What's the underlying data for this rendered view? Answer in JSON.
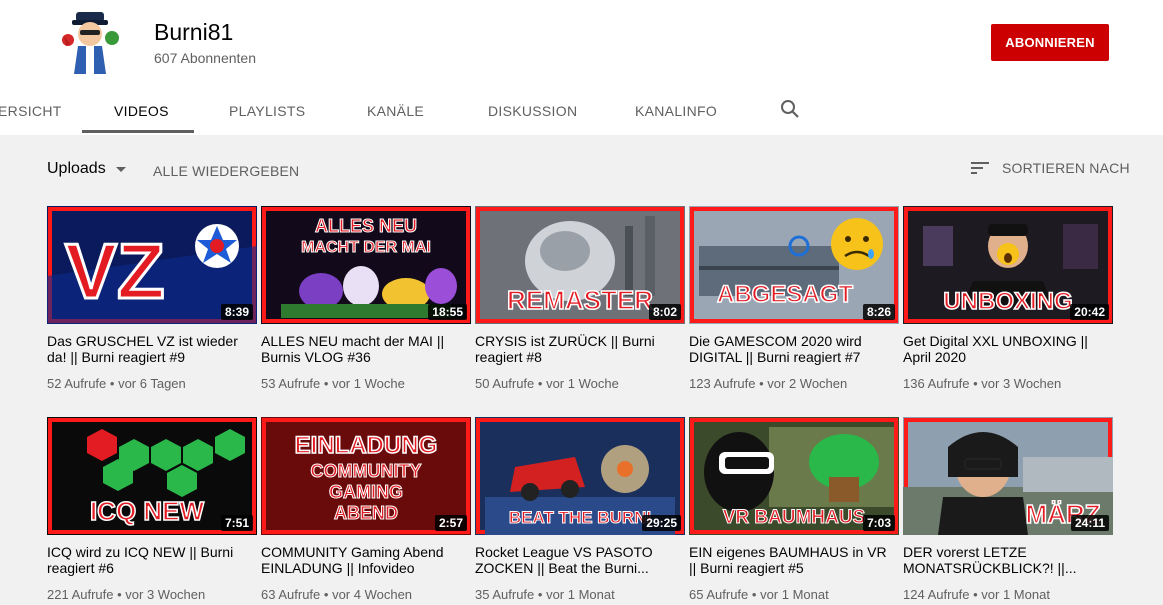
{
  "channel": {
    "name": "Burni81",
    "subscribers": "607 Abonnenten",
    "subscribe_label": "ABONNIEREN"
  },
  "tabs": [
    {
      "label": "ÜBERSICHT"
    },
    {
      "label": "VIDEOS"
    },
    {
      "label": "PLAYLISTS"
    },
    {
      "label": "KANÄLE"
    },
    {
      "label": "DISKUSSION"
    },
    {
      "label": "KANALINFO"
    }
  ],
  "toolbar": {
    "uploads_label": "Uploads",
    "play_all_label": "ALLE WIEDERGEBEN",
    "sort_label": "SORTIEREN NACH"
  },
  "colors": {
    "accent": "#cc0000",
    "background": "#f1f1f1"
  },
  "videos": [
    {
      "title": "Das GRUSCHEL VZ ist wieder da! || Burni reagiert #9",
      "views": "52 Aufrufe",
      "age": "vor 6 Tagen",
      "duration": "8:39",
      "thumb_text": "VZ"
    },
    {
      "title": "ALLES NEU macht der MAI || Burnis VLOG #36",
      "views": "53 Aufrufe",
      "age": "vor 1 Woche",
      "duration": "18:55",
      "thumb_text": "ALLES NEU MACHT DER MAI"
    },
    {
      "title": "CRYSIS ist ZURÜCK || Burni reagiert #8",
      "views": "50 Aufrufe",
      "age": "vor 1 Woche",
      "duration": "8:02",
      "thumb_text": "REMASTER"
    },
    {
      "title": "Die GAMESCOM 2020 wird DIGITAL || Burni reagiert #7",
      "views": "123 Aufrufe",
      "age": "vor 2 Wochen",
      "duration": "8:26",
      "thumb_text": "ABGESAGT"
    },
    {
      "title": "Get Digital XXL UNBOXING || April 2020",
      "views": "136 Aufrufe",
      "age": "vor 3 Wochen",
      "duration": "20:42",
      "thumb_text": "UNBOXING"
    },
    {
      "title": "ICQ wird zu ICQ NEW || Burni reagiert #6",
      "views": "221 Aufrufe",
      "age": "vor 3 Wochen",
      "duration": "7:51",
      "thumb_text": "ICQ NEW"
    },
    {
      "title": "COMMUNITY Gaming Abend EINLADUNG || Infovideo",
      "views": "63 Aufrufe",
      "age": "vor 4 Wochen",
      "duration": "2:57",
      "thumb_text": "EINLADUNG COMMUNITY GAMING ABEND"
    },
    {
      "title": "Rocket League VS PASOTO ZOCKEN || Beat the Burni...",
      "views": "35 Aufrufe",
      "age": "vor 1 Monat",
      "duration": "29:25",
      "thumb_text": "BEAT THE BURNI"
    },
    {
      "title": "EIN eigenes BAUMHAUS in VR || Burni reagiert #5",
      "views": "65 Aufrufe",
      "age": "vor 1 Monat",
      "duration": "7:03",
      "thumb_text": "VR BAUMHAUS"
    },
    {
      "title": "DER vorerst LETZE MONATSRÜCKBLICK?! ||...",
      "views": "124 Aufrufe",
      "age": "vor 1 Monat",
      "duration": "24:11",
      "thumb_text": "MÄRZ"
    }
  ]
}
